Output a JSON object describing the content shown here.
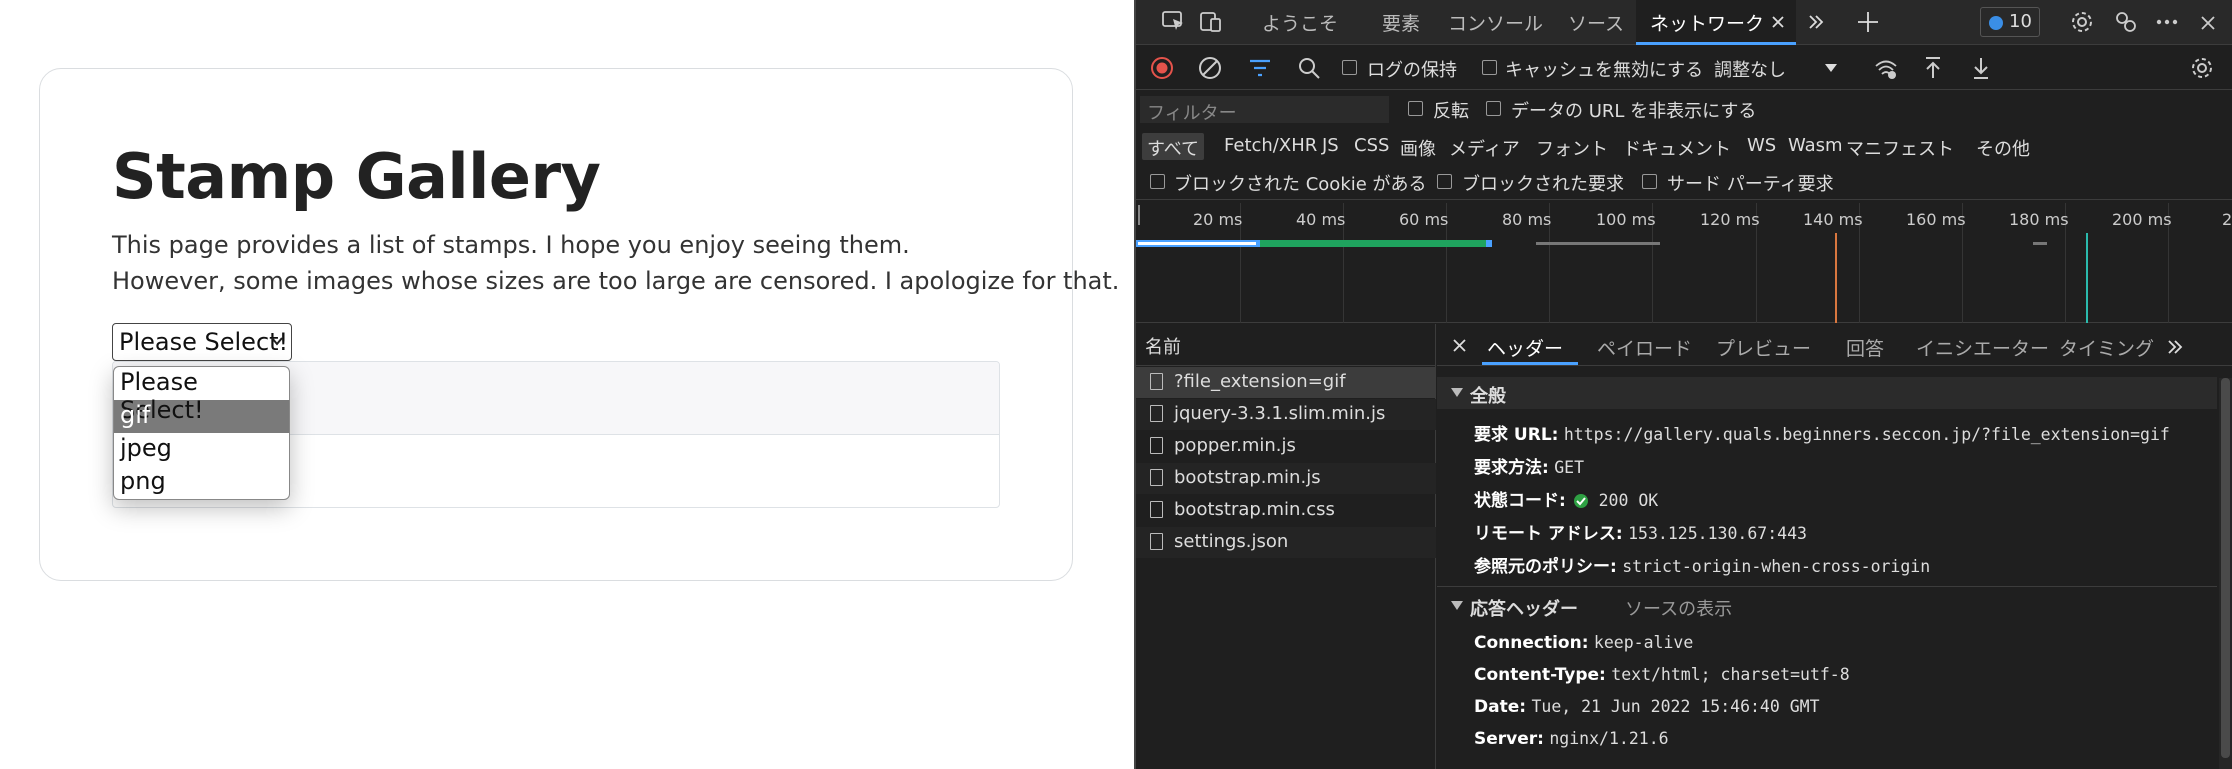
{
  "page": {
    "title": "Stamp Gallery",
    "intro_line1": "This page provides a list of stamps. I hope you enjoy seeing them.",
    "intro_line2": "However, some images whose sizes are too large are censored. I apologize for that.",
    "select_value": "Please Select!",
    "table_rows": [
      "gif",
      ""
    ],
    "dropdown_options": [
      "Please Select!",
      "gif",
      "jpeg",
      "png"
    ],
    "dropdown_selected_index": 1
  },
  "devtools": {
    "tabs": {
      "welcome": "ようこそ",
      "elements": "要素",
      "console": "コンソール",
      "sources": "ソース",
      "network": "ネットワーク"
    },
    "issues_count": "10",
    "toolbar": {
      "preserve_log": "ログの保持",
      "disable_cache": "キャッシュを無効にする",
      "throttle": "調整なし"
    },
    "filter": {
      "placeholder": "フィルター",
      "invert": "反転",
      "hide_data_urls": "データの URL を非表示にする"
    },
    "types": [
      "すべて",
      "Fetch/XHR",
      "JS",
      "CSS",
      "画像",
      "メディア",
      "フォント",
      "ドキュメント",
      "WS",
      "Wasm",
      "マニフェスト",
      "その他"
    ],
    "block_filters": {
      "blocked_cookies": "ブロックされた Cookie がある",
      "blocked_requests": "ブロックされた要求",
      "third_party": "サード パーティ要求"
    },
    "timeline_ticks": [
      "20 ms",
      "40 ms",
      "60 ms",
      "80 ms",
      "100 ms",
      "120 ms",
      "140 ms",
      "160 ms",
      "180 ms",
      "200 ms",
      "2"
    ],
    "requests_header": "名前",
    "requests": [
      "?file_extension=gif",
      "jquery-3.3.1.slim.min.js",
      "popper.min.js",
      "bootstrap.min.js",
      "bootstrap.min.css",
      "settings.json"
    ],
    "detail_tabs": [
      "ヘッダー",
      "ペイロード",
      "プレビュー",
      "回答",
      "イニシエーター",
      "タイミング"
    ],
    "general": {
      "section": "全般",
      "request_url_label": "要求 URL:",
      "request_url": "https://gallery.quals.beginners.seccon.jp/?file_extension=gif",
      "method_label": "要求方法:",
      "method": "GET",
      "status_label": "状態コード:",
      "status": "200 OK",
      "remote_label": "リモート アドレス:",
      "remote": "153.125.130.67:443",
      "referrer_label": "参照元のポリシー:",
      "referrer": "strict-origin-when-cross-origin"
    },
    "response": {
      "section": "応答ヘッダー",
      "view_source": "ソースの表示",
      "connection_label": "Connection:",
      "connection": "keep-alive",
      "content_type_label": "Content-Type:",
      "content_type": "text/html; charset=utf-8",
      "date_label": "Date:",
      "date": "Tue, 21 Jun 2022 15:46:40 GMT",
      "server_label": "Server:",
      "server": "nginx/1.21.6"
    },
    "colors": {
      "accent": "#4aa1ff",
      "bg": "#1f1f1f",
      "waterfall_blue": "#4aa1ff",
      "waterfall_green": "#1fa35e",
      "status_ok": "#2ea043"
    }
  }
}
